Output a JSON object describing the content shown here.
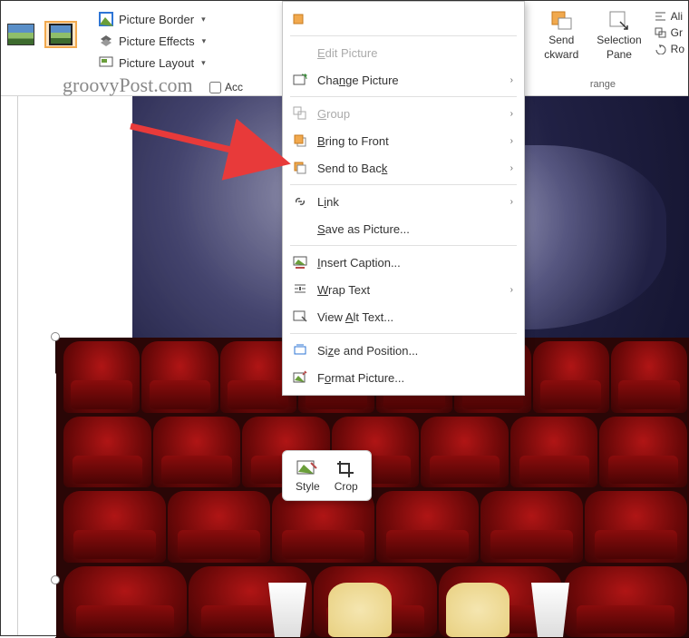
{
  "ribbon": {
    "picture_border": "Picture Border",
    "picture_effects": "Picture Effects",
    "picture_layout": "Picture Layout",
    "accessibility_label": "Acc",
    "send_backward": "Send",
    "send_backward2": "ckward",
    "selection_pane": "Selection",
    "selection_pane2": "Pane",
    "align": "Ali",
    "group": "Gr",
    "rotate": "Ro",
    "arrange_label": "range"
  },
  "watermark": "groovyPost.com",
  "context_menu": {
    "edit_picture": "Edit Picture",
    "change_picture": "Change Picture",
    "group": "Group",
    "bring_to_front": "Bring to Front",
    "send_to_back": "Send to Back",
    "link": "Link",
    "save_as_picture": "Save as Picture...",
    "insert_caption": "Insert Caption...",
    "wrap_text": "Wrap Text",
    "view_alt_text": "View Alt Text...",
    "size_and_position": "Size and Position...",
    "format_picture": "Format Picture..."
  },
  "mini_toolbar": {
    "style": "Style",
    "crop": "Crop"
  }
}
